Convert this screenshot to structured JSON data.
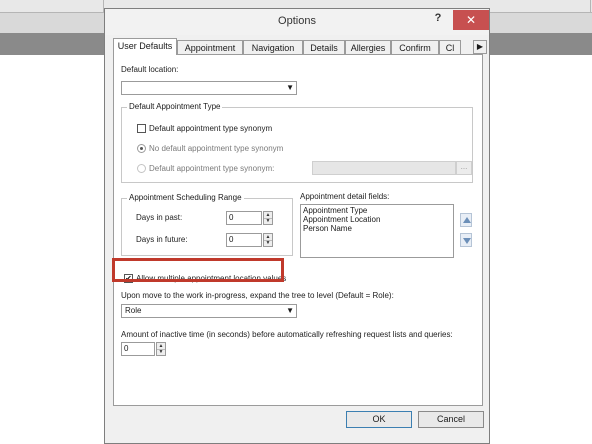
{
  "window": {
    "title": "Options",
    "help_glyph": "?",
    "close_glyph": "✕"
  },
  "tabs": [
    {
      "label": "User Defaults",
      "active": true
    },
    {
      "label": "Appointment",
      "active": false
    },
    {
      "label": "Navigation",
      "active": false
    },
    {
      "label": "Details",
      "active": false
    },
    {
      "label": "Allergies",
      "active": false
    },
    {
      "label": "Confirm",
      "active": false
    },
    {
      "label": "Cl",
      "active": false
    }
  ],
  "tab_scroll_glyph": "▶",
  "default_location": {
    "label": "Default location:",
    "value": ""
  },
  "appointment_type": {
    "group_title": "Default Appointment Type",
    "synonym_checkbox_label": "Default appointment type synonym",
    "synonym_checked": false,
    "radio_none_label": "No default appointment type synonym",
    "radio_default_label": "Default appointment type synonym:",
    "synonym_value": "",
    "browse_label": "..."
  },
  "scheduling_range": {
    "group_title": "Appointment Scheduling Range",
    "days_past_label": "Days in past:",
    "days_past_value": "0",
    "days_future_label": "Days in future:",
    "days_future_value": "0"
  },
  "detail_fields": {
    "label": "Appointment detail fields:",
    "items": [
      "Appointment Type",
      "Appointment Location",
      "Person Name"
    ]
  },
  "allow_multiple": {
    "label": "Allow multiple appointment location values",
    "checked": true,
    "check_glyph": "✔"
  },
  "expand_tree": {
    "label": "Upon move to the work in-progress, expand the tree to level (Default = Role):",
    "value": "Role"
  },
  "inactive_time": {
    "label": "Amount of inactive time (in seconds) before automatically refreshing request lists and queries:",
    "value": "0"
  },
  "buttons": {
    "ok": "OK",
    "cancel": "Cancel"
  },
  "colors": {
    "highlight": "#c0392b",
    "close": "#c75050"
  }
}
